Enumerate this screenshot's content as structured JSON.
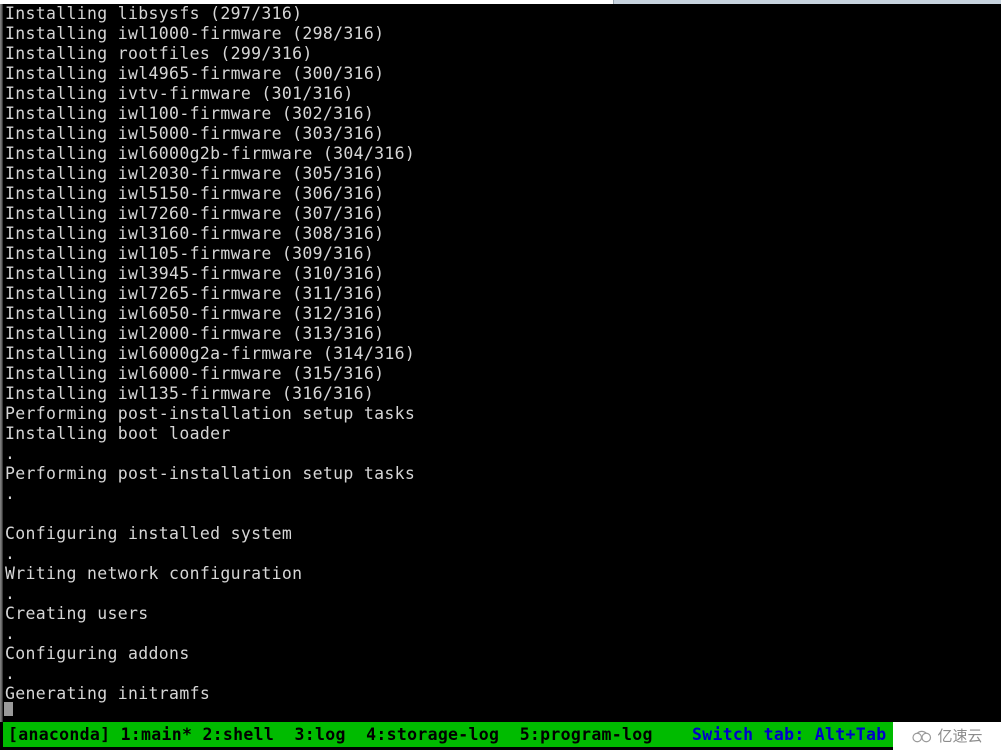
{
  "window": {
    "title": "anaconda installer console",
    "background_color": "#000000",
    "text_color": "#d6d6d6",
    "chrome_color": "#c7d3de"
  },
  "console": {
    "package_total": 316,
    "lines": [
      "Installing libsysfs (297/316)",
      "Installing iwl1000-firmware (298/316)",
      "Installing rootfiles (299/316)",
      "Installing iwl4965-firmware (300/316)",
      "Installing ivtv-firmware (301/316)",
      "Installing iwl100-firmware (302/316)",
      "Installing iwl5000-firmware (303/316)",
      "Installing iwl6000g2b-firmware (304/316)",
      "Installing iwl2030-firmware (305/316)",
      "Installing iwl5150-firmware (306/316)",
      "Installing iwl7260-firmware (307/316)",
      "Installing iwl3160-firmware (308/316)",
      "Installing iwl105-firmware (309/316)",
      "Installing iwl3945-firmware (310/316)",
      "Installing iwl7265-firmware (311/316)",
      "Installing iwl6050-firmware (312/316)",
      "Installing iwl2000-firmware (313/316)",
      "Installing iwl6000g2a-firmware (314/316)",
      "Installing iwl6000-firmware (315/316)",
      "Installing iwl135-firmware (316/316)",
      "Performing post-installation setup tasks",
      "Installing boot loader",
      ".",
      "Performing post-installation setup tasks",
      ".",
      "",
      "Configuring installed system",
      ".",
      "Writing network configuration",
      ".",
      "Creating users",
      ".",
      "Configuring addons",
      ".",
      "Generating initramfs"
    ]
  },
  "statusbar": {
    "background_color": "#00bb00",
    "text_color": "#000000",
    "hint_color": "#0000cc",
    "session_label": "[anaconda]",
    "tabs_text": "1:main* 2:shell  3:log  4:storage-log  5:program-log",
    "left_text": "[anaconda] 1:main* 2:shell  3:log  4:storage-log  5:program-log",
    "tabs": [
      {
        "index": "1",
        "name": "main",
        "label": "1:main*",
        "active": true
      },
      {
        "index": "2",
        "name": "shell",
        "label": "2:shell",
        "active": false
      },
      {
        "index": "3",
        "name": "log",
        "label": "3:log",
        "active": false
      },
      {
        "index": "4",
        "name": "storage-log",
        "label": "4:storage-log",
        "active": false
      },
      {
        "index": "5",
        "name": "program-log",
        "label": "5:program-log",
        "active": false
      }
    ],
    "hint": "Switch tab: Alt+Tab"
  },
  "watermark": {
    "text": "亿速云",
    "icon": "cloud-icon",
    "color": "#8c8c8c",
    "background": "#ffffff"
  }
}
